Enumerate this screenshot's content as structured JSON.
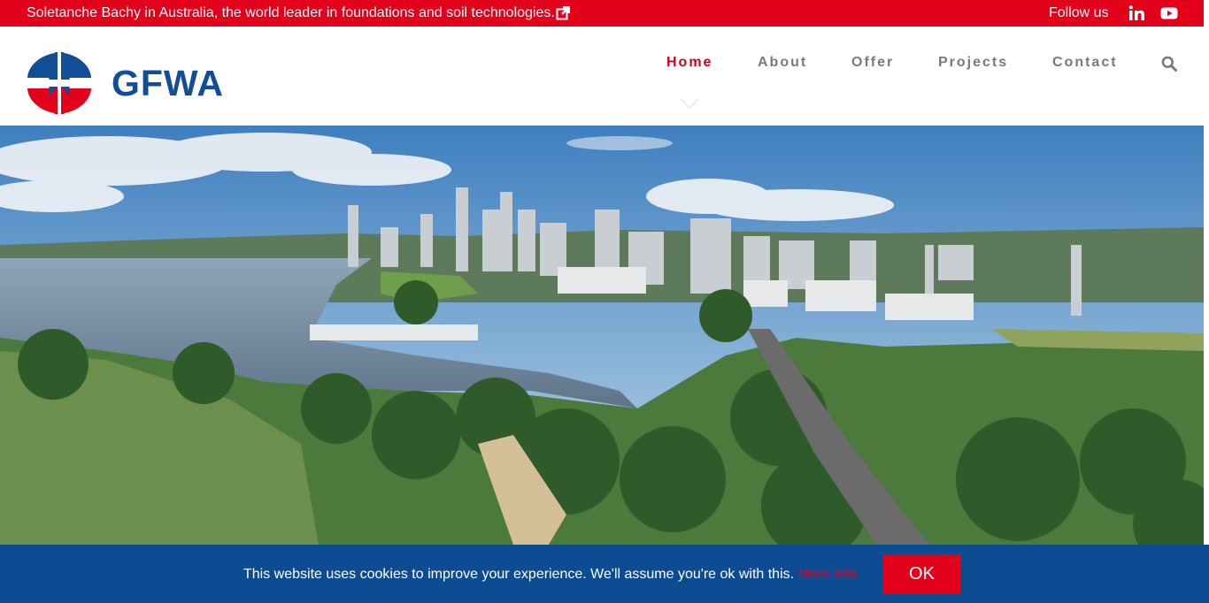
{
  "topbar": {
    "message": "Soletanche Bachy in Australia, the world leader in foundations and soil technologies.",
    "follow_label": "Follow us",
    "icons": [
      "external-link-icon",
      "linkedin-icon",
      "youtube-icon"
    ],
    "bg_color": "#e3001b"
  },
  "header": {
    "logo_text": "GFWA",
    "nav": [
      {
        "label": "Home",
        "active": true
      },
      {
        "label": "About",
        "active": false
      },
      {
        "label": "Offer",
        "active": false
      },
      {
        "label": "Projects",
        "active": false
      },
      {
        "label": "Contact",
        "active": false
      }
    ],
    "icons": [
      "search-icon"
    ],
    "active_color": "#d4001a"
  },
  "hero": {
    "image": "aerial view of Perth city skyline, Swan River and parkland"
  },
  "cookie": {
    "text": "This website uses cookies to improve your experience. We'll assume you're ok with this.",
    "more_label": "More info",
    "ok_label": "OK",
    "bg_color": "#0d4c92"
  }
}
